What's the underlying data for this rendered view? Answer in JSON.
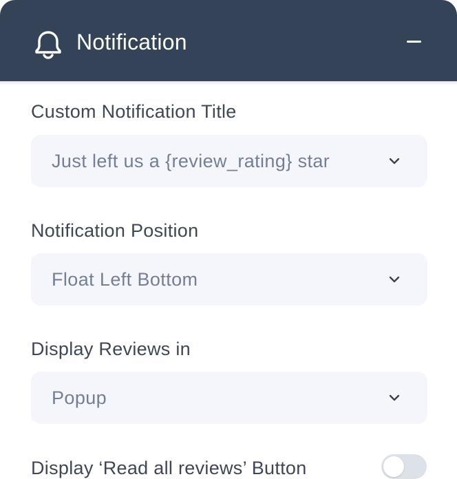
{
  "header": {
    "title": "Notification",
    "icon": "bell-icon",
    "collapse_icon": "minus-icon"
  },
  "fields": {
    "custom_title": {
      "label": "Custom Notification Title",
      "value": "Just left us a {review_rating} star"
    },
    "position": {
      "label": "Notification Position",
      "value": "Float Left Bottom"
    },
    "display_in": {
      "label": "Display Reviews in",
      "value": "Popup"
    },
    "read_all_button": {
      "label": "Display ‘Read all reviews’ Button",
      "enabled": false
    }
  },
  "colors": {
    "header_bg": "#344358",
    "select_bg": "#f4f6fb",
    "label_text": "#3f4756",
    "value_text": "#747f94"
  }
}
